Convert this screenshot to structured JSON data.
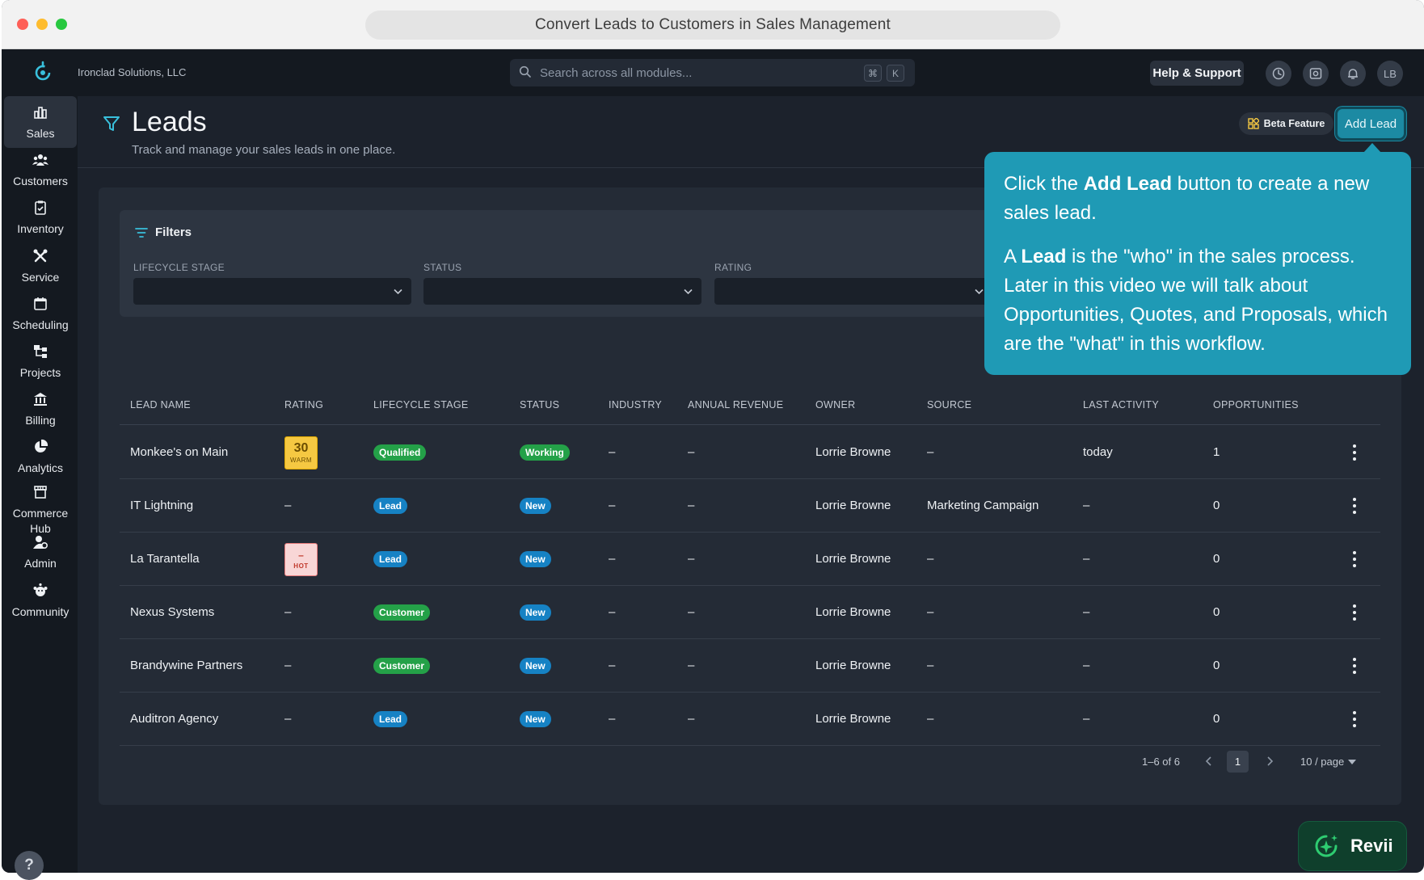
{
  "browser": {
    "title": "Convert Leads to Customers in Sales Management"
  },
  "topbar": {
    "company": "Ironclad Solutions, LLC",
    "search_placeholder": "Search across all modules...",
    "kbd_cmd": "⌘",
    "kbd_k": "K",
    "help_label": "Help & Support",
    "avatar_initials": "LB"
  },
  "sidebar": {
    "items": [
      {
        "label": "Sales",
        "icon": "bar-chart-icon"
      },
      {
        "label": "Customers",
        "icon": "users-icon"
      },
      {
        "label": "Inventory",
        "icon": "clipboard-icon"
      },
      {
        "label": "Service",
        "icon": "tools-icon"
      },
      {
        "label": "Scheduling",
        "icon": "calendar-icon"
      },
      {
        "label": "Projects",
        "icon": "hierarchy-icon"
      },
      {
        "label": "Billing",
        "icon": "bank-icon"
      },
      {
        "label": "Analytics",
        "icon": "pie-chart-icon"
      },
      {
        "label": "Commerce Hub",
        "icon": "store-icon"
      },
      {
        "label": "Admin",
        "icon": "user-gear-icon"
      },
      {
        "label": "Community",
        "icon": "community-icon"
      }
    ],
    "help": "?"
  },
  "header": {
    "title": "Leads",
    "subtitle": "Track and manage your sales leads in one place.",
    "beta_label": "Beta Feature",
    "add_label": "Add Lead"
  },
  "filters": {
    "title": "Filters",
    "fields": [
      "LIFECYCLE STAGE",
      "STATUS",
      "RATING"
    ]
  },
  "table": {
    "columns": [
      "LEAD NAME",
      "RATING",
      "LIFECYCLE STAGE",
      "STATUS",
      "INDUSTRY",
      "ANNUAL REVENUE",
      "OWNER",
      "SOURCE",
      "LAST ACTIVITY",
      "OPPORTUNITIES"
    ],
    "rows": [
      {
        "name": "Monkee's on Main",
        "rating": "",
        "rating_num": "30",
        "rating_word": "WARM",
        "stage": "Qualified",
        "status": "Working",
        "industry": "–",
        "revenue": "–",
        "owner": "Lorrie Browne",
        "source": "–",
        "last_activity": "today",
        "opportunities": "1"
      },
      {
        "name": "IT Lightning",
        "rating": "–",
        "stage": "Lead",
        "status": "New",
        "industry": "–",
        "revenue": "–",
        "owner": "Lorrie Browne",
        "source": "Marketing Campaign",
        "last_activity": "–",
        "opportunities": "0"
      },
      {
        "name": "La Tarantella",
        "rating": "",
        "rating_num": "–",
        "rating_word": "HOT",
        "stage": "Lead",
        "status": "New",
        "industry": "–",
        "revenue": "–",
        "owner": "Lorrie Browne",
        "source": "–",
        "last_activity": "–",
        "opportunities": "0"
      },
      {
        "name": "Nexus Systems",
        "rating": "–",
        "stage": "Customer",
        "status": "New",
        "industry": "–",
        "revenue": "–",
        "owner": "Lorrie Browne",
        "source": "–",
        "last_activity": "–",
        "opportunities": "0"
      },
      {
        "name": "Brandywine Partners",
        "rating": "–",
        "stage": "Customer",
        "status": "New",
        "industry": "–",
        "revenue": "–",
        "owner": "Lorrie Browne",
        "source": "–",
        "last_activity": "–",
        "opportunities": "0"
      },
      {
        "name": "Auditron Agency",
        "rating": "–",
        "stage": "Lead",
        "status": "New",
        "industry": "–",
        "revenue": "–",
        "owner": "Lorrie Browne",
        "source": "–",
        "last_activity": "–",
        "opportunities": "0"
      }
    ]
  },
  "pagination": {
    "range": "1–6 of 6",
    "page": "1",
    "page_size": "10 / page"
  },
  "tooltip": {
    "p1_a": "Click the ",
    "p1_b": "Add Lead",
    "p1_c": " button to create a new sales lead.",
    "p2_a": "A ",
    "p2_b": "Lead",
    "p2_c": " is the \"who\" in the sales process. Later in this video we will talk about Opportunities, Quotes, and Proposals, which are the \"what\" in this workflow."
  },
  "assistant": {
    "label": "Revii"
  },
  "colors": {
    "accent": "#1f9ab5",
    "green": "#24a148",
    "blue": "#1682c4",
    "background": "#1c222c"
  }
}
